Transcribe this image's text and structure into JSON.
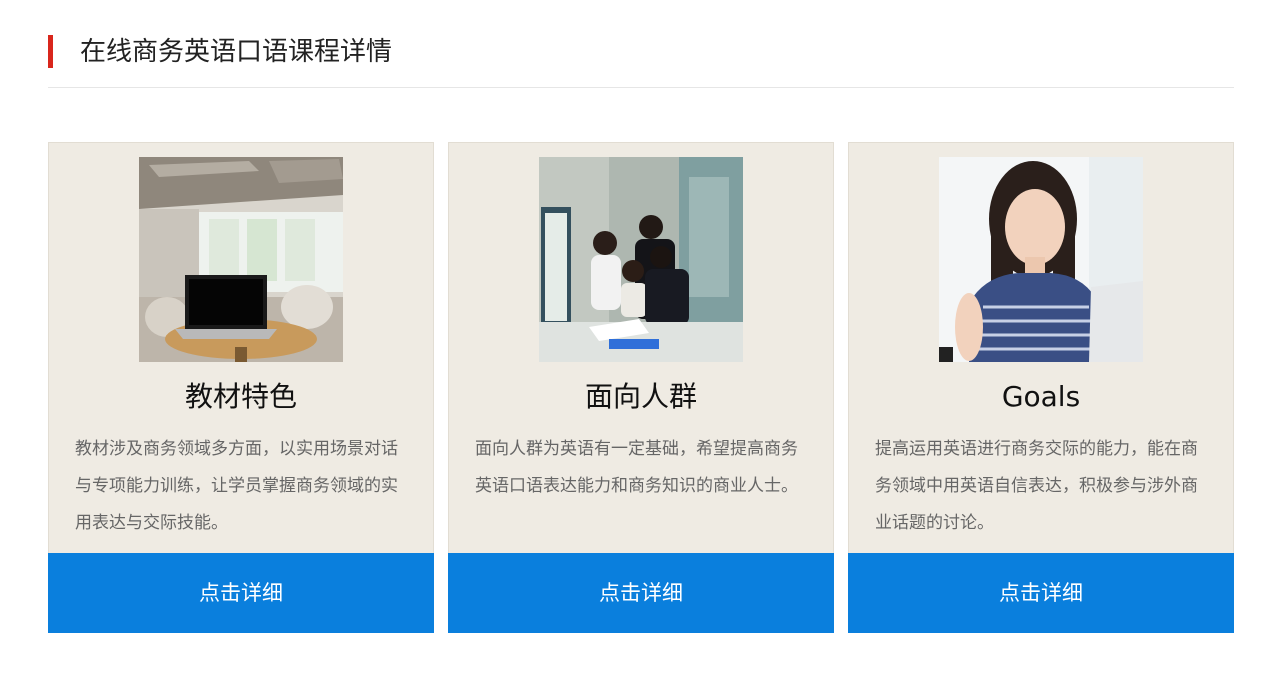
{
  "header": {
    "title": "在线商务英语口语课程详情",
    "accent_color": "#d9261c"
  },
  "cards": [
    {
      "image_name": "laptop-on-table-photo",
      "title": "教材特色",
      "description": "教材涉及商务领域多方面，以实用场景对话与专项能力训练，让学员掌握商务领域的实用表达与交际技能。",
      "button_label": "点击详细"
    },
    {
      "image_name": "business-team-meeting-photo",
      "title": "面向人群",
      "description": "面向人群为英语有一定基础，希望提高商务英语口语表达能力和商务知识的商业人士。",
      "button_label": "点击详细"
    },
    {
      "image_name": "smiling-woman-laptop-photo",
      "title": "Goals",
      "description": "提高运用英语进行商务交际的能力，能在商务领域中用英语自信表达，积极参与涉外商业话题的讨论。",
      "button_label": "点击详细"
    }
  ],
  "colors": {
    "button_bg": "#0a7fdd",
    "card_bg": "#efebe3"
  }
}
